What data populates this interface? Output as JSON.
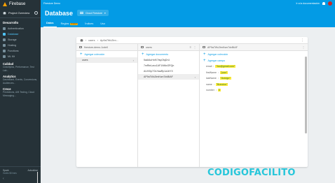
{
  "brand": {
    "name": "Firebase"
  },
  "sidebar": {
    "project_label": "Project Overview",
    "section_develop": "Desarrollo",
    "items": [
      {
        "label": "Authentication",
        "active": false
      },
      {
        "label": "Database",
        "active": true
      },
      {
        "label": "Storage",
        "active": false
      },
      {
        "label": "Hosting",
        "active": false
      },
      {
        "label": "Functions",
        "active": false
      },
      {
        "label": "ML Kit",
        "active": false
      }
    ],
    "groups": [
      {
        "title": "Calidad",
        "subtitle": "Crashlytics, Performance, Test Lab..."
      },
      {
        "title": "Analytics",
        "subtitle": "Dashboard, Events, Conversions, Audiences..."
      },
      {
        "title": "Crece",
        "subtitle": "Predictions, A/B Testing, Cloud Messaging..."
      }
    ],
    "plan": "Spark",
    "plan_action": "Actualizar",
    "plan_desc": "Gratis $0/mes"
  },
  "header": {
    "project_name": "Firestore Demo",
    "link_docs": "Ir a la documentación",
    "title": "Database",
    "db_selector": "Cloud Firestore",
    "tabs": [
      {
        "label": "Datos",
        "active": true,
        "badge": ""
      },
      {
        "label": "Reglas",
        "active": false,
        "badge": "NUEVO"
      },
      {
        "label": "Índices",
        "active": false,
        "badge": ""
      },
      {
        "label": "Uso",
        "active": false,
        "badge": ""
      }
    ]
  },
  "panel": {
    "breadcrumb": [
      "users",
      "Ap9a7Wc2tm..."
    ],
    "columns": [
      {
        "header": "firestore-demo-1cde0",
        "add_label": "Agregar colección",
        "items": [
          {
            "label": "users",
            "selected": true
          }
        ]
      },
      {
        "header": "users",
        "add_label": "Agregar documento",
        "items": [
          {
            "label": "5aAlAuHxfX7tsyGfqDrU",
            "selected": false
          },
          {
            "label": "7mRtnLavc1AF1NMoGRQn",
            "selected": false
          },
          {
            "label": "AUV0lp7OLHaaRp1a1bYX",
            "selected": false
          },
          {
            "label": "AP9a7Wc2tmKsm7dvBtAF",
            "selected": true
          }
        ]
      },
      {
        "header": "AP9a7Wc2tmKsm7dvBtAF",
        "add_collection_label": "Agregar colección",
        "add_field_label": "Agregar campo",
        "fields": [
          {
            "key": "email",
            "value": "\"foo@gmail.com\""
          },
          {
            "key": "firstName",
            "value": "\"juan\""
          },
          {
            "key": "lastName",
            "value": "\"Arango\""
          },
          {
            "key": "name",
            "value": "\"Brandon\""
          },
          {
            "key": "number",
            "value": "3"
          }
        ]
      }
    ]
  },
  "watermark": "CODIGOFACILITO"
}
